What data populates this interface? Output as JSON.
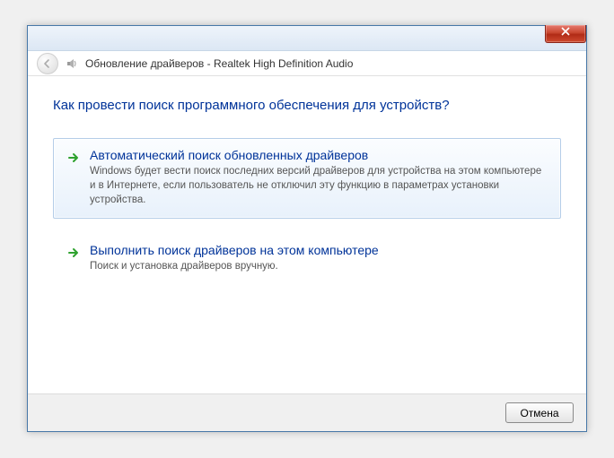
{
  "titlebar": {
    "window_title": "Обновление драйверов - Realtek High Definition Audio"
  },
  "heading": "Как провести поиск программного обеспечения для устройств?",
  "options": [
    {
      "title": "Автоматический поиск обновленных драйверов",
      "desc": "Windows будет вести поиск последних версий драйверов для устройства на этом компьютере и в Интернете, если пользователь не отключил эту функцию в параметрах установки устройства."
    },
    {
      "title": "Выполнить поиск драйверов на этом компьютере",
      "desc": "Поиск и установка драйверов вручную."
    }
  ],
  "footer": {
    "cancel": "Отмена"
  }
}
